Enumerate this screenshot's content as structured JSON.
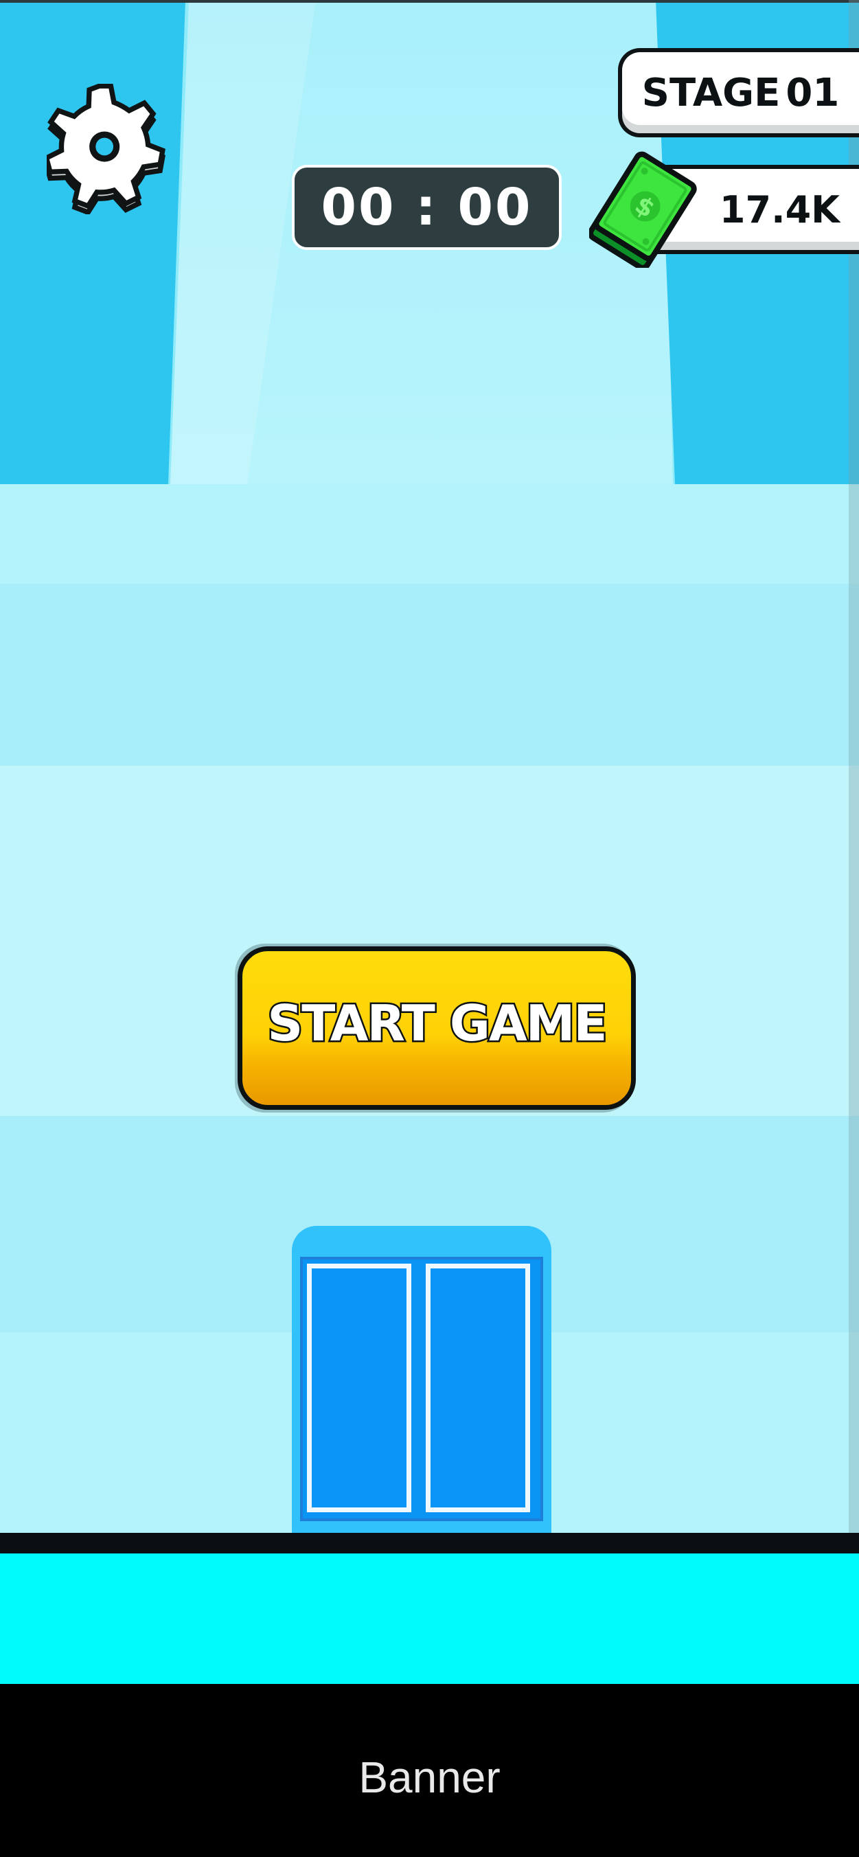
{
  "hud": {
    "timer": "00 : 00",
    "stage_label": "STAGE",
    "stage_number": "01",
    "cash": "17.4K"
  },
  "buttons": {
    "start_label": "START GAME"
  },
  "banner": {
    "label": "Banner"
  },
  "icons": {
    "settings": "gear-icon",
    "cash": "cash-bill-icon"
  },
  "colors": {
    "start_button": "#FFD106",
    "timer_bg": "#2E3D40",
    "floor": "#00FBFD",
    "walls": "#2EC6EF",
    "door": "#0B95F9"
  }
}
